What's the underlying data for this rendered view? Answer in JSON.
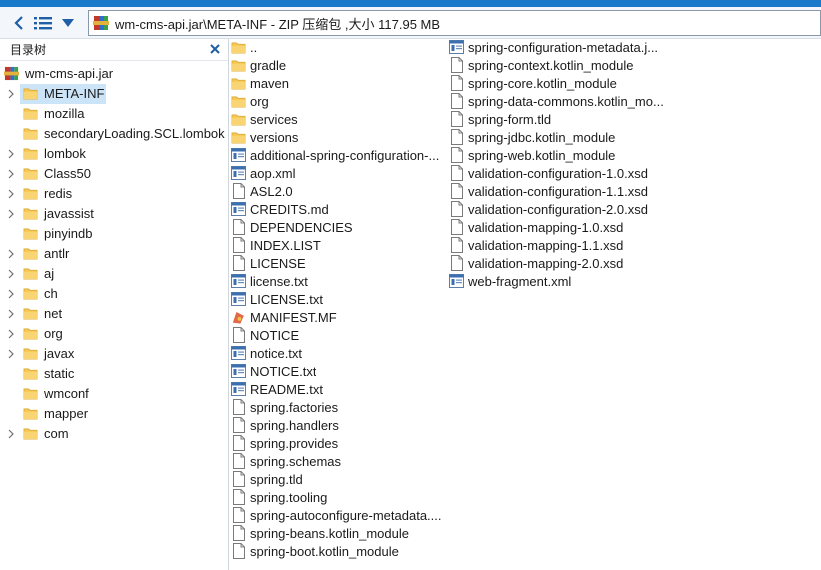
{
  "window": {
    "address": "wm-cms-api.jar\\META-INF - ZIP 压缩包 ,大小 117.95 MB"
  },
  "sidebar": {
    "title": "目录树",
    "root": "wm-cms-api.jar",
    "folders": [
      {
        "label": "META-INF",
        "chevron": true,
        "selected": true
      },
      {
        "label": "mozilla",
        "chevron": false
      },
      {
        "label": "secondaryLoading.SCL.lombok",
        "chevron": false
      },
      {
        "label": "lombok",
        "chevron": true
      },
      {
        "label": "Class50",
        "chevron": true
      },
      {
        "label": "redis",
        "chevron": true
      },
      {
        "label": "javassist",
        "chevron": true
      },
      {
        "label": "pinyindb",
        "chevron": false
      },
      {
        "label": "antlr",
        "chevron": true
      },
      {
        "label": "aj",
        "chevron": true
      },
      {
        "label": "ch",
        "chevron": true
      },
      {
        "label": "net",
        "chevron": true
      },
      {
        "label": "org",
        "chevron": true
      },
      {
        "label": "javax",
        "chevron": true
      },
      {
        "label": "static",
        "chevron": false
      },
      {
        "label": "wmconf",
        "chevron": false
      },
      {
        "label": "mapper",
        "chevron": false
      },
      {
        "label": "com",
        "chevron": true
      }
    ]
  },
  "files": {
    "column1": [
      {
        "name": "..",
        "icon": "folder"
      },
      {
        "name": "gradle",
        "icon": "folder"
      },
      {
        "name": "maven",
        "icon": "folder"
      },
      {
        "name": "org",
        "icon": "folder"
      },
      {
        "name": "services",
        "icon": "folder"
      },
      {
        "name": "versions",
        "icon": "folder"
      },
      {
        "name": "additional-spring-configuration-...",
        "icon": "doc-blue"
      },
      {
        "name": "aop.xml",
        "icon": "doc-blue"
      },
      {
        "name": "ASL2.0",
        "icon": "doc"
      },
      {
        "name": "CREDITS.md",
        "icon": "doc-blue"
      },
      {
        "name": "DEPENDENCIES",
        "icon": "doc"
      },
      {
        "name": "INDEX.LIST",
        "icon": "doc"
      },
      {
        "name": "LICENSE",
        "icon": "doc"
      },
      {
        "name": "license.txt",
        "icon": "doc-blue"
      },
      {
        "name": "LICENSE.txt",
        "icon": "doc-blue"
      },
      {
        "name": "MANIFEST.MF",
        "icon": "manifest"
      },
      {
        "name": "NOTICE",
        "icon": "doc"
      },
      {
        "name": "notice.txt",
        "icon": "doc-blue"
      },
      {
        "name": "NOTICE.txt",
        "icon": "doc-blue"
      },
      {
        "name": "README.txt",
        "icon": "doc-blue"
      },
      {
        "name": "spring.factories",
        "icon": "doc"
      },
      {
        "name": "spring.handlers",
        "icon": "doc"
      },
      {
        "name": "spring.provides",
        "icon": "doc"
      },
      {
        "name": "spring.schemas",
        "icon": "doc"
      },
      {
        "name": "spring.tld",
        "icon": "doc"
      },
      {
        "name": "spring.tooling",
        "icon": "doc"
      },
      {
        "name": "spring-autoconfigure-metadata....",
        "icon": "doc"
      },
      {
        "name": "spring-beans.kotlin_module",
        "icon": "doc"
      },
      {
        "name": "spring-boot.kotlin_module",
        "icon": "doc"
      }
    ],
    "column2": [
      {
        "name": "spring-configuration-metadata.j...",
        "icon": "doc-blue"
      },
      {
        "name": "spring-context.kotlin_module",
        "icon": "doc"
      },
      {
        "name": "spring-core.kotlin_module",
        "icon": "doc"
      },
      {
        "name": "spring-data-commons.kotlin_mo...",
        "icon": "doc"
      },
      {
        "name": "spring-form.tld",
        "icon": "doc"
      },
      {
        "name": "spring-jdbc.kotlin_module",
        "icon": "doc"
      },
      {
        "name": "spring-web.kotlin_module",
        "icon": "doc"
      },
      {
        "name": "validation-configuration-1.0.xsd",
        "icon": "doc"
      },
      {
        "name": "validation-configuration-1.1.xsd",
        "icon": "doc"
      },
      {
        "name": "validation-configuration-2.0.xsd",
        "icon": "doc"
      },
      {
        "name": "validation-mapping-1.0.xsd",
        "icon": "doc"
      },
      {
        "name": "validation-mapping-1.1.xsd",
        "icon": "doc"
      },
      {
        "name": "validation-mapping-2.0.xsd",
        "icon": "doc"
      },
      {
        "name": "web-fragment.xml",
        "icon": "doc-blue"
      }
    ]
  },
  "colors": {
    "accent": "#1979ca",
    "folder": "#f5c650",
    "selection": "#cce4f7"
  }
}
